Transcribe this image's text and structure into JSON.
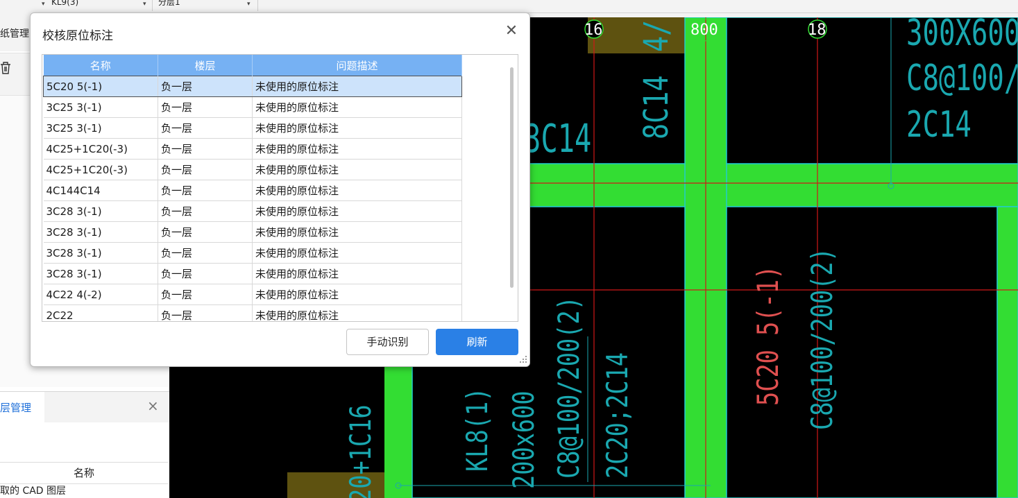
{
  "toolbar": {
    "combo1": "KL9(3)",
    "combo2": "分层1"
  },
  "left_panel": {
    "tab_drawing": "纸管理",
    "tab_layer": "层管理",
    "grid_header": "名称",
    "grid_first_row": "取的 CAD 图层"
  },
  "dialog": {
    "title": "校核原位标注",
    "columns": [
      "名称",
      "楼层",
      "问题描述"
    ],
    "rows": [
      {
        "name": "5C20 5(-1)",
        "floor": "负一层",
        "issue": "未使用的原位标注"
      },
      {
        "name": "3C25 3(-1)",
        "floor": "负一层",
        "issue": "未使用的原位标注"
      },
      {
        "name": "3C25 3(-1)",
        "floor": "负一层",
        "issue": "未使用的原位标注"
      },
      {
        "name": "4C25+1C20(-3)",
        "floor": "负一层",
        "issue": "未使用的原位标注"
      },
      {
        "name": "4C25+1C20(-3)",
        "floor": "负一层",
        "issue": "未使用的原位标注"
      },
      {
        "name": "4C144C14",
        "floor": "负一层",
        "issue": "未使用的原位标注"
      },
      {
        "name": "3C28 3(-1)",
        "floor": "负一层",
        "issue": "未使用的原位标注"
      },
      {
        "name": "3C28 3(-1)",
        "floor": "负一层",
        "issue": "未使用的原位标注"
      },
      {
        "name": "3C28 3(-1)",
        "floor": "负一层",
        "issue": "未使用的原位标注"
      },
      {
        "name": "3C28 3(-1)",
        "floor": "负一层",
        "issue": "未使用的原位标注"
      },
      {
        "name": "4C22 4(-2)",
        "floor": "负一层",
        "issue": "未使用的原位标注"
      },
      {
        "name": "2C22",
        "floor": "负一层",
        "issue": "未使用的原位标注"
      }
    ],
    "selected_row": 0,
    "btn_manual": "手动识别",
    "btn_refresh": "刷新"
  },
  "cad": {
    "axis_labels": [
      "16",
      "800",
      "18"
    ],
    "annotations": {
      "top_right_1": "300X600",
      "top_right_2": "C8@100/",
      "top_right_3": "2C14",
      "col_8c14": "8C14",
      "col_4": "4/",
      "left_3c14": "3C14",
      "red_5c20": "5C20 5(-1)",
      "cyan_stirrup": "C8@100/200(2)",
      "mid_stirrup": "C8@100/200(2)",
      "mid_2c20": "2C20;2C14",
      "mid_size": "200x600",
      "mid_kl8": "KL8(1)",
      "left_bottom": "20+1C16"
    },
    "colors": {
      "beam_green": "#33dd33",
      "axis_red": "#d01818",
      "text_cyan": "#1aa8b0",
      "text_red": "#e05050",
      "fill_olive": "#5e5210"
    }
  }
}
